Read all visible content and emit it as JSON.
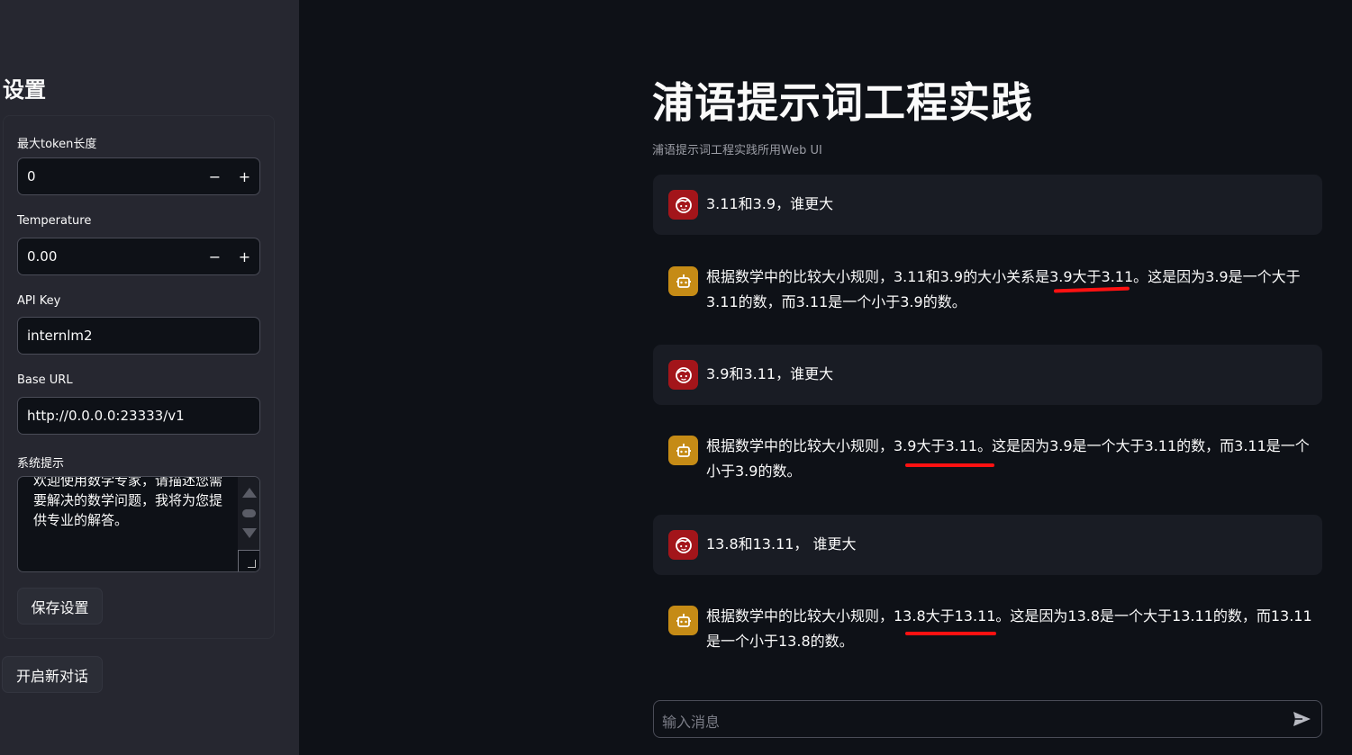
{
  "sidebar": {
    "title": "设置",
    "max_tokens": {
      "label": "最大token长度",
      "value": "0",
      "minus": "−",
      "plus": "+"
    },
    "temperature": {
      "label": "Temperature",
      "value": "0.00",
      "minus": "−",
      "plus": "+"
    },
    "api_key": {
      "label": "API Key",
      "value": "internlm2"
    },
    "base_url": {
      "label": "Base URL",
      "value": "http://0.0.0.0:23333/v1"
    },
    "system_prompt": {
      "label": "系统提示",
      "value": "欢迎使用数学专家，请描述您需要解决的数学问题，我将为您提供专业的解答。"
    },
    "save_button": "保存设置",
    "new_chat_button": "开启新对话"
  },
  "main": {
    "title": "浦语提示词工程实践",
    "subtitle": "浦语提示词工程实践所用Web UI"
  },
  "messages": [
    {
      "role": "user",
      "text": "3.11和3.9，谁更大",
      "avatar_icon": "user-face-icon"
    },
    {
      "role": "assistant",
      "text": "根据数学中的比较大小规则，3.11和3.9的大小关系是3.9大于3.11。这是因为3.9是一个大于3.11的数，而3.11是一个小于3.9的数。",
      "avatar_icon": "robot-icon",
      "highlight": "3.9大于3.11"
    },
    {
      "role": "user",
      "text": "3.9和3.11，谁更大",
      "avatar_icon": "user-face-icon"
    },
    {
      "role": "assistant",
      "text": "根据数学中的比较大小规则，3.9大于3.11。这是因为3.9是一个大于3.11的数，而3.11是一个小于3.9的数。",
      "avatar_icon": "robot-icon",
      "highlight": "3.9大于3.11"
    },
    {
      "role": "user",
      "text": "13.8和13.11， 谁更大",
      "avatar_icon": "user-face-icon"
    },
    {
      "role": "assistant",
      "text": "根据数学中的比较大小规则，13.8大于13.11。这是因为13.8是一个大于13.11的数，而13.11是一个小于13.8的数。",
      "avatar_icon": "robot-icon",
      "highlight": "13.8大于13.11"
    }
  ],
  "chat_input": {
    "placeholder": "输入消息",
    "send_icon": "send-icon"
  },
  "colors": {
    "app_bg": "#0e1117",
    "sidebar_bg": "#262730",
    "user_avatar": "#a3151a",
    "bot_avatar": "#c58b16",
    "annotation": "#ff1111"
  }
}
